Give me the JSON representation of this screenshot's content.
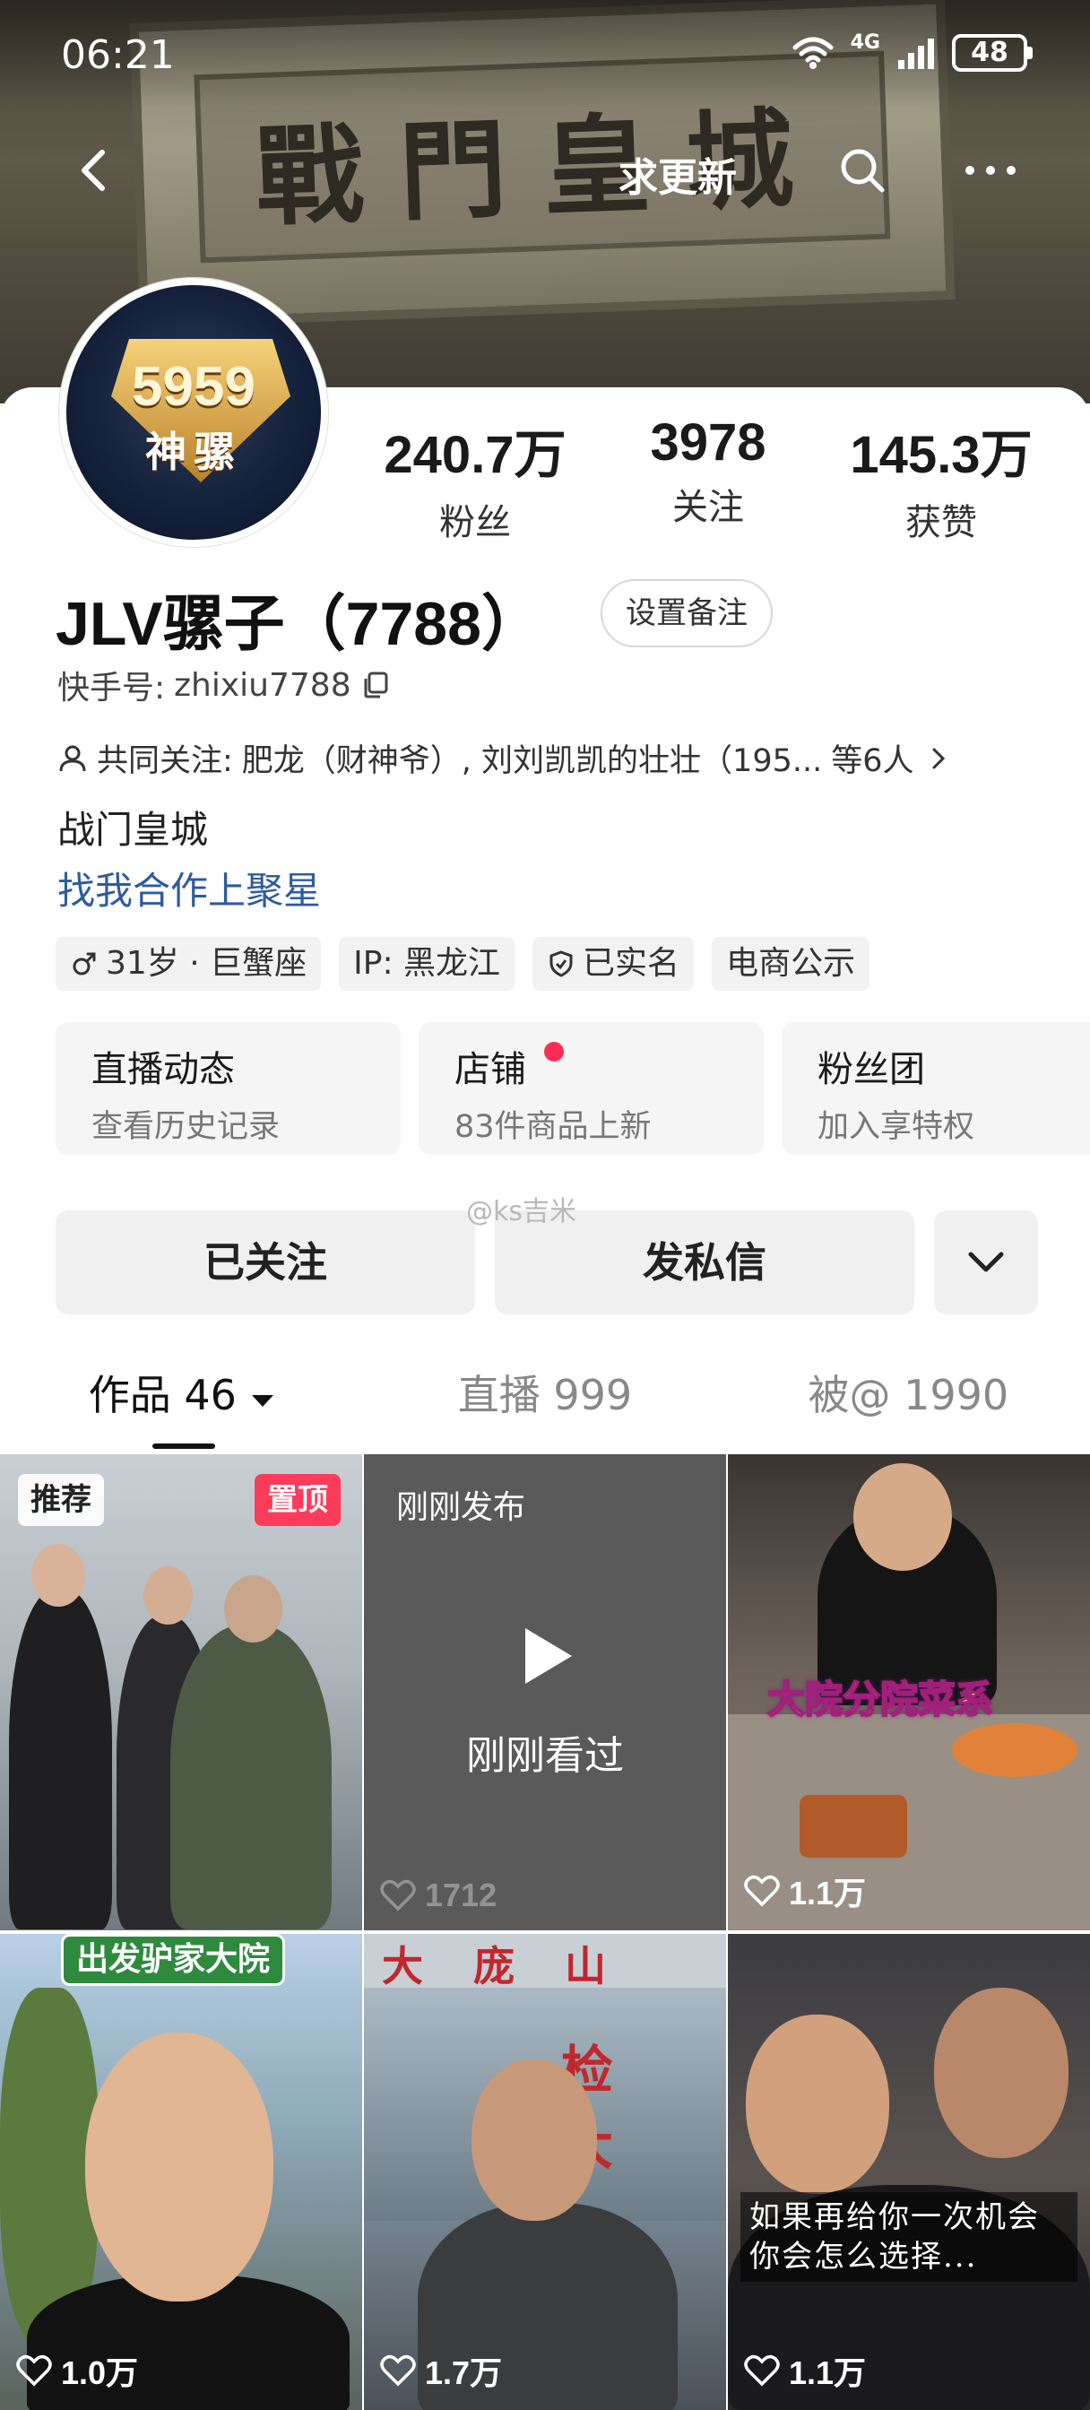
{
  "status_bar": {
    "time": "06:21",
    "network": "4G",
    "battery": "48"
  },
  "nav": {
    "title": "求更新"
  },
  "banner": {
    "plaque_text": "戰門皇城"
  },
  "profile": {
    "avatar_number": "5959",
    "avatar_word": "神骡",
    "username": "JLV骡子（7788）",
    "remark_button": "设置备注",
    "account_label": "快手号:",
    "account_id": "zhixiu7788",
    "mutual_label": "共同关注:",
    "mutual_names": "肥龙（财神爷）, 刘刘凯凯的壮壮（195...",
    "mutual_count": "等6人",
    "bio": "战门皇城",
    "coop_link": "找我合作上聚星"
  },
  "stats": [
    {
      "value": "240.7万",
      "label": "粉丝"
    },
    {
      "value": "3978",
      "label": "关注"
    },
    {
      "value": "145.3万",
      "label": "获赞"
    }
  ],
  "tags": [
    {
      "label": "31岁 · 巨蟹座",
      "icon": "male-icon"
    },
    {
      "label": "IP: 黑龙江",
      "icon": ""
    },
    {
      "label": "已实名",
      "icon": "shield-icon"
    },
    {
      "label": "电商公示",
      "icon": ""
    }
  ],
  "features": [
    {
      "title": "直播动态",
      "subtitle": "查看历史记录"
    },
    {
      "title": "店铺",
      "subtitle": "83件商品上新",
      "red_dot": true
    },
    {
      "title": "粉丝团",
      "subtitle": "加入享特权"
    }
  ],
  "watermark": "@ks吉米",
  "actions": {
    "follow": "已关注",
    "message": "发私信"
  },
  "tabs": [
    {
      "label": "作品 46",
      "active": true
    },
    {
      "label": "直播 999",
      "active": false
    },
    {
      "label": "被@ 1990",
      "active": false
    }
  ],
  "videos": [
    {
      "chip_left": "推荐",
      "chip_right": "置顶",
      "likes": ""
    },
    {
      "top_text": "刚刚发布",
      "center_text": "刚刚看过",
      "likes": "1712"
    },
    {
      "caption": "大院分院菜系",
      "likes": "1.1万"
    },
    {
      "banner": "出发驴家大院",
      "likes": "1.0万"
    },
    {
      "storefront": "大 庞 山",
      "sign": "检 大",
      "likes": "1.7万"
    },
    {
      "quote_line1": "如果再给你一次机会",
      "quote_line2": "你会怎么选择...",
      "likes": "1.1万"
    }
  ],
  "colors": {
    "accent_red": "#ff2d55",
    "link_blue": "#2d5b9e",
    "pin_red": "#ff3b5c"
  }
}
